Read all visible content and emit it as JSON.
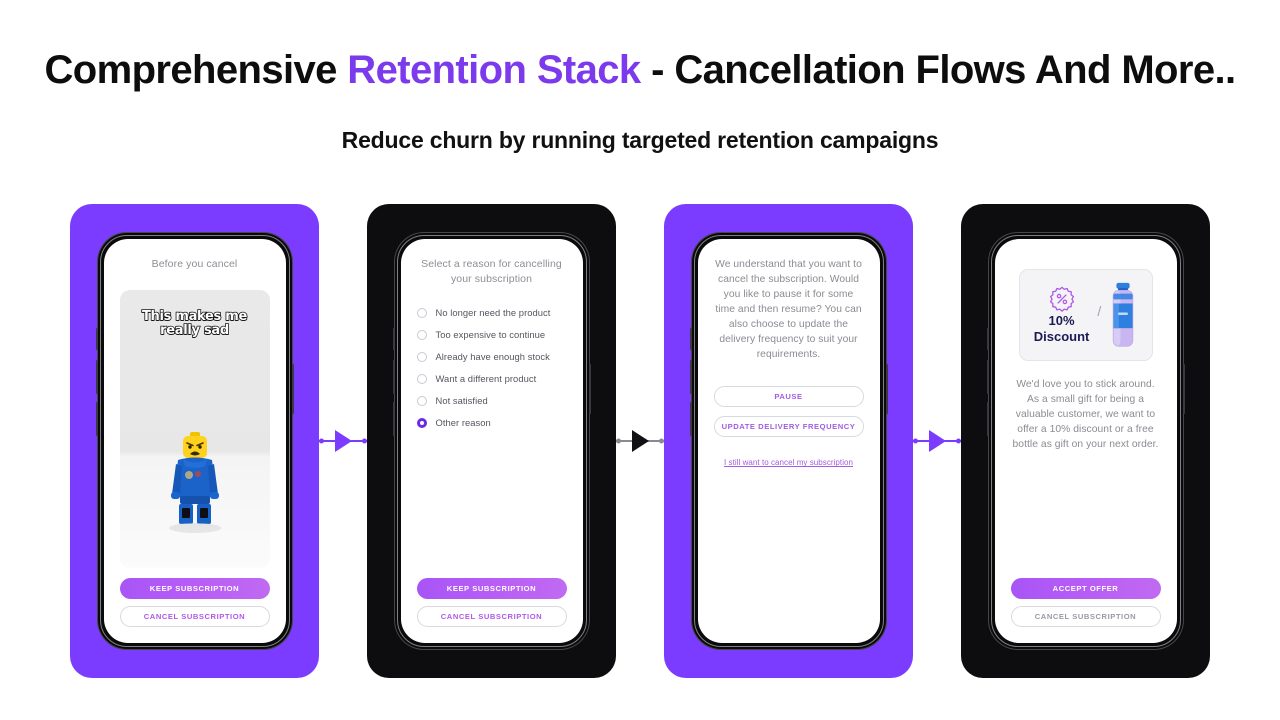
{
  "header": {
    "title_part1": "Comprehensive ",
    "title_accent": "Retention Stack",
    "title_part2": " - Cancellation Flows And More..",
    "subtitle": "Reduce churn by running targeted retention campaigns"
  },
  "colors": {
    "panel_purple": "#7B3CFF",
    "panel_dark": "#0d0d0f",
    "accent": "#7C3AED",
    "button_primary": "#b95ef5",
    "link": "#a35ce0"
  },
  "screens": [
    {
      "panel_style": "purple",
      "heading": "Before you cancel",
      "meme": {
        "line1": "This makes me",
        "line2": "really sad",
        "alt": "sad-lego-minifigure"
      },
      "buttons": [
        {
          "label": "KEEP SUBSCRIPTION",
          "style": "primary"
        },
        {
          "label": "CANCEL SUBSCRIPTION",
          "style": "outline"
        }
      ]
    },
    {
      "panel_style": "dark",
      "heading": "Select a reason for cancelling your subscription",
      "options": [
        {
          "label": "No longer need the product",
          "selected": false
        },
        {
          "label": "Too expensive to continue",
          "selected": false
        },
        {
          "label": "Already have enough stock",
          "selected": false
        },
        {
          "label": "Want a different product",
          "selected": false
        },
        {
          "label": "Not satisfied",
          "selected": false
        },
        {
          "label": "Other reason",
          "selected": true
        }
      ],
      "buttons": [
        {
          "label": "KEEP SUBSCRIPTION",
          "style": "primary"
        },
        {
          "label": "CANCEL SUBSCRIPTION",
          "style": "outline"
        }
      ]
    },
    {
      "panel_style": "purple",
      "body": "We understand that you want to cancel the subscription. Would you like to pause it for some time and then resume? You can also choose to update the delivery frequency to suit your requirements.",
      "buttons": [
        {
          "label": "PAUSE",
          "style": "outline"
        },
        {
          "label": "UPDATE DELIVERY FREQUENCY",
          "style": "outline"
        }
      ],
      "link": "I still want to cancel my subscription"
    },
    {
      "panel_style": "dark",
      "offer": {
        "discount_amount": "10%",
        "discount_word": "Discount",
        "separator": "/",
        "badge_icon": "percent-rosette-icon",
        "product_icon": "water-bottle-icon"
      },
      "body": "We'd love you to stick around. As a small gift for being a valuable customer, we want to offer a 10% discount or a free bottle as gift on your next order.",
      "buttons": [
        {
          "label": "ACCEPT OFFER",
          "style": "primary"
        },
        {
          "label": "CANCEL SUBSCRIPTION",
          "style": "outline-muted"
        }
      ]
    }
  ],
  "connectors": [
    {
      "style": "purple",
      "icon": "arrow-right-icon"
    },
    {
      "style": "dark",
      "icon": "arrow-right-icon"
    },
    {
      "style": "purple",
      "icon": "arrow-right-icon"
    }
  ]
}
